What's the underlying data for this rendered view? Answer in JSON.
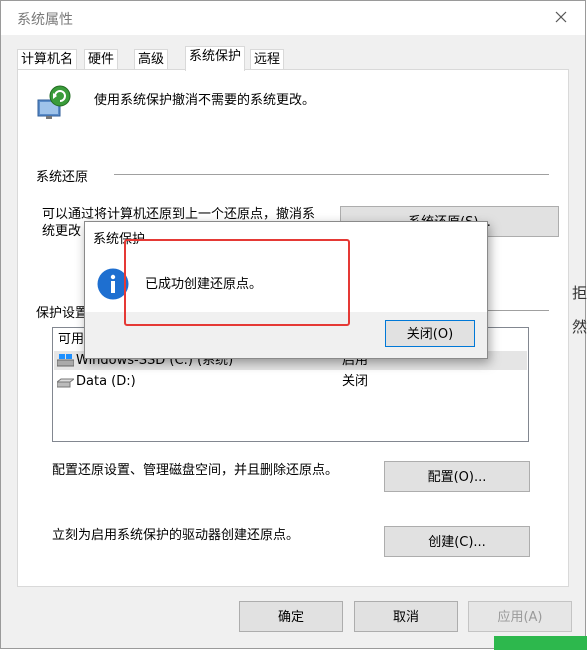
{
  "window": {
    "title": "系统属性"
  },
  "tabs": [
    {
      "label": "计算机名"
    },
    {
      "label": "硬件"
    },
    {
      "label": "高级"
    },
    {
      "label": "系统保护"
    },
    {
      "label": "远程"
    }
  ],
  "panel": {
    "intro": "使用系统保护撤消不需要的系统更改。",
    "restore": {
      "heading": "系统还原",
      "desc_line1": "可以通过将计算机还原到上一个还原点，撤消系",
      "desc_line2": "统更改",
      "button": "系统还原(S)..."
    },
    "protection": {
      "heading": "保护设置",
      "col_available": "可用",
      "drives": [
        {
          "name": "Windows-SSD (C:) (系统)",
          "status": "启用"
        },
        {
          "name": "Data (D:)",
          "status": "关闭"
        }
      ]
    },
    "configure": {
      "text": "配置还原设置、管理磁盘空间，并且删除还原点。",
      "button": "配置(O)..."
    },
    "create": {
      "text": "立刻为启用系统保护的驱动器创建还原点。",
      "button": "创建(C)..."
    }
  },
  "footer": {
    "ok": "确定",
    "cancel": "取消",
    "apply": "应用(A)"
  },
  "dialog": {
    "title": "系统保护",
    "message": "已成功创建还原点。",
    "close_button": "关闭(O)"
  },
  "background": {
    "frag1": "拒",
    "frag2": "然"
  },
  "colors": {
    "info_blue": "#1e6fd0",
    "highlight_red": "#e53935",
    "accent_green": "#2db84d"
  }
}
